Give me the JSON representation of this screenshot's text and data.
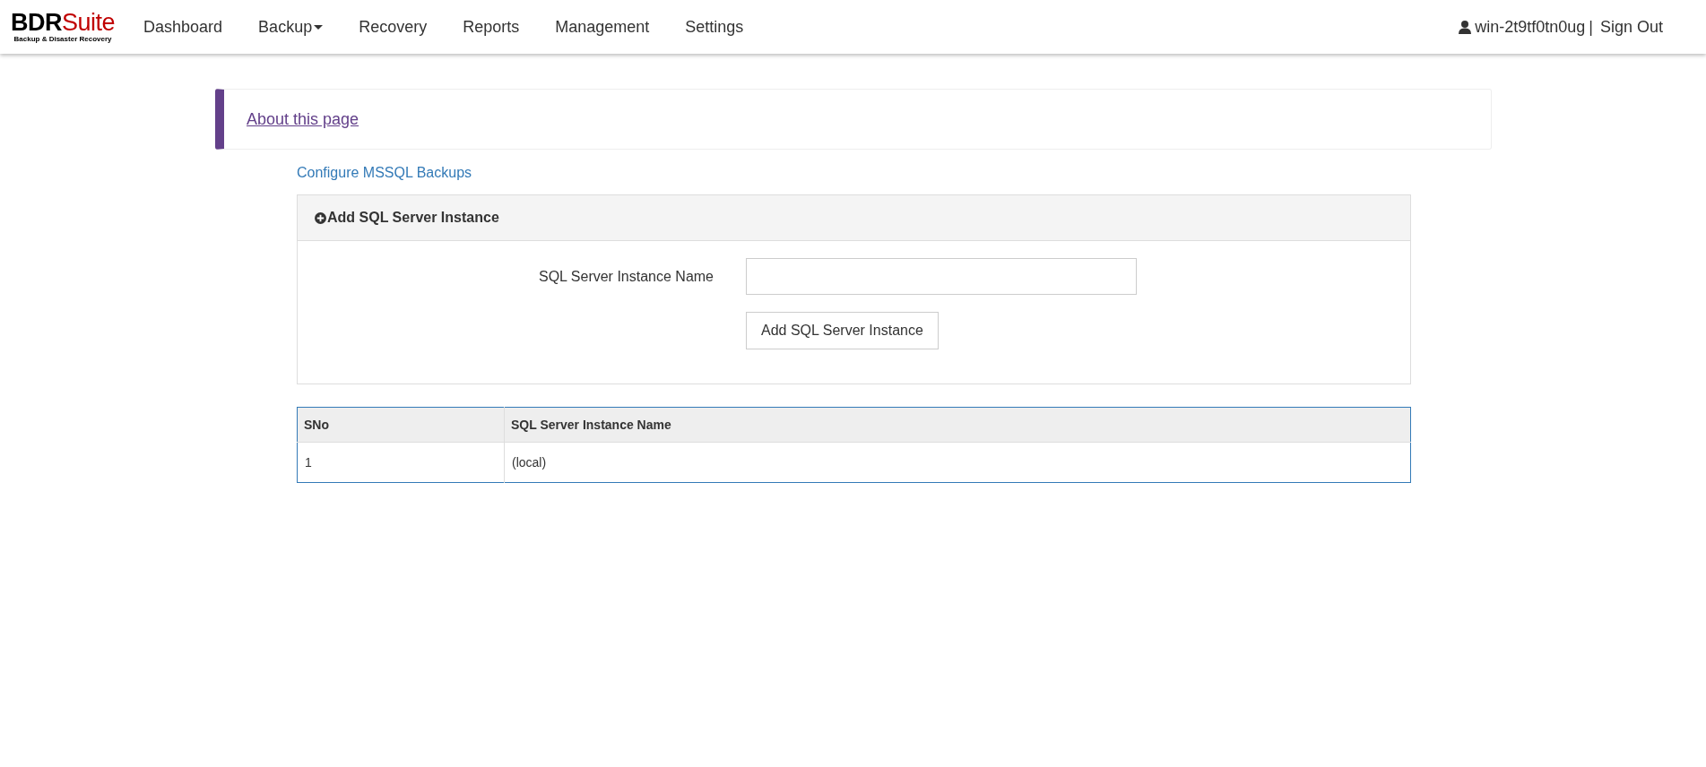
{
  "header": {
    "logo": {
      "wordmark_dark": "BDR",
      "wordmark_accent": "Suite",
      "tagline": "Backup & Disaster Recovery"
    },
    "nav": [
      {
        "label": "Dashboard",
        "kind": "link"
      },
      {
        "label": "Backup",
        "kind": "dropdown"
      },
      {
        "label": "Recovery",
        "kind": "link"
      },
      {
        "label": "Reports",
        "kind": "link"
      },
      {
        "label": "Management",
        "kind": "link"
      },
      {
        "label": "Settings",
        "kind": "link"
      }
    ],
    "user": "win-2t9tf0tn0ug",
    "separator": "|",
    "sign_out": "Sign Out"
  },
  "about": {
    "link": "About this page"
  },
  "breadcrumb": "Configure MSSQL Backups",
  "panel": {
    "title": "Add SQL Server Instance",
    "field_label": "SQL Server Instance Name",
    "button": "Add SQL Server Instance"
  },
  "table": {
    "columns": [
      "SNo",
      "SQL Server Instance Name"
    ],
    "rows": [
      [
        "1",
        "(local)"
      ]
    ]
  }
}
